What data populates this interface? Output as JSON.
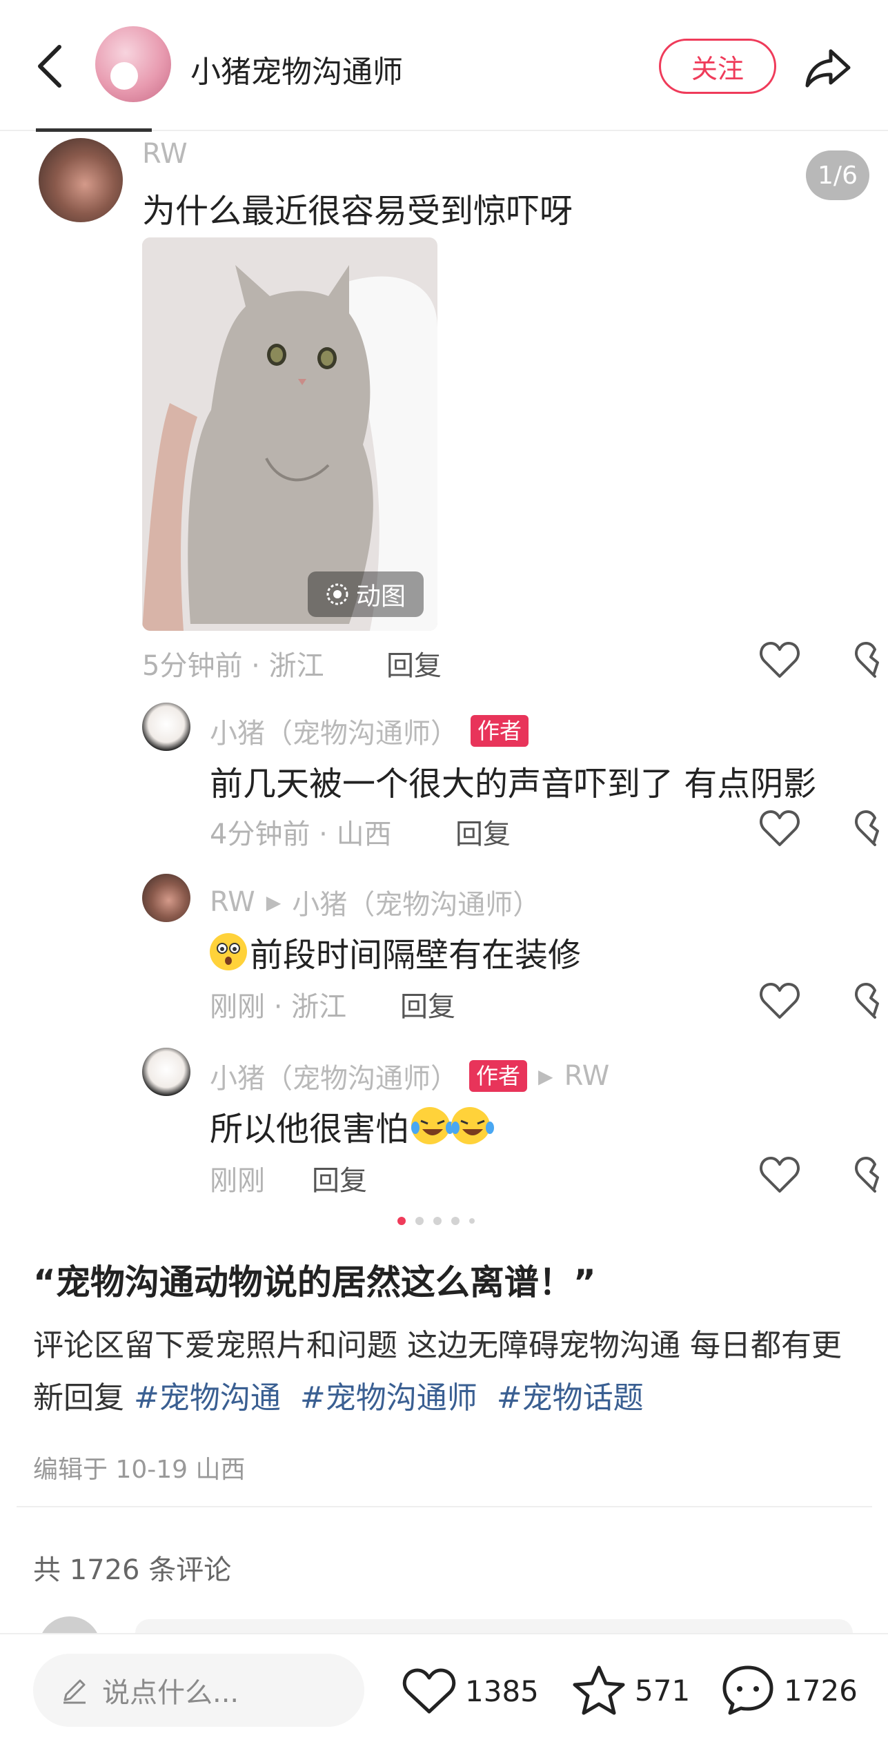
{
  "header": {
    "title": "小猪宠物沟通师",
    "follow_label": "关注"
  },
  "slide": {
    "pager": "1/6",
    "gif_label": "动图",
    "comments": [
      {
        "name": "RW",
        "text": "为什么最近很容易受到惊吓呀",
        "meta": "5分钟前 · 浙江",
        "reply": "回复"
      },
      {
        "name": "小猪（宠物沟通师）",
        "badge": "作者",
        "text": "前几天被一个很大的声音吓到了 有点阴影",
        "meta": "4分钟前 · 山西",
        "reply": "回复"
      },
      {
        "name": "RW",
        "reply_to": "小猪（宠物沟通师）",
        "text": "前段时间隔壁有在装修",
        "meta": "刚刚 · 浙江",
        "reply": "回复"
      },
      {
        "name": "小猪（宠物沟通师）",
        "badge": "作者",
        "reply_to": "RW",
        "text": "所以他很害怕",
        "meta": "刚刚",
        "reply": "回复"
      }
    ]
  },
  "note": {
    "title": "“宠物沟通动物说的居然这么离谱！”",
    "body": "评论区留下爱宠照片和问题 这边无障碍宠物沟通 每日都有更新回复",
    "tags": [
      "#宠物沟通",
      "#宠物沟通师",
      "#宠物话题"
    ],
    "edit_meta": "编辑于 10-19 山西",
    "comment_count": "共 1726 条评论"
  },
  "bottom_bar": {
    "input_placeholder": "说点什么...",
    "likes": "1385",
    "favorites": "571",
    "comments": "1726"
  },
  "colors": {
    "accent": "#ef3b5a",
    "tag": "#3a5f92",
    "badge": "#e8345a"
  }
}
